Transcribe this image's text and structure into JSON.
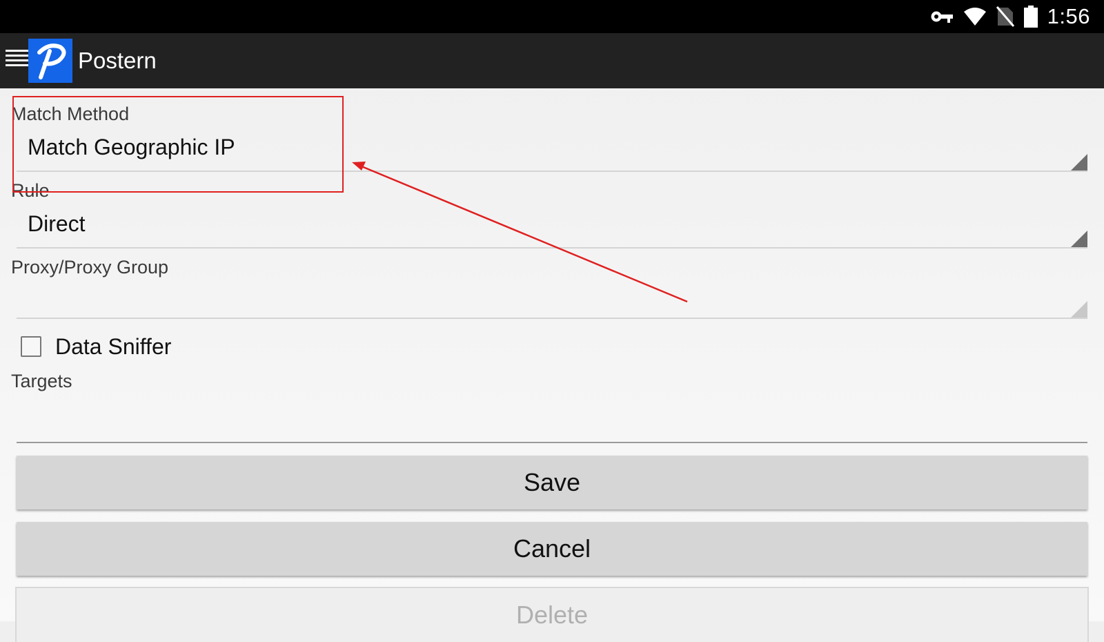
{
  "status_bar": {
    "time": "1:56",
    "icons": [
      "vpn-key-icon",
      "wifi-icon",
      "no-sim-icon",
      "battery-icon"
    ]
  },
  "app_bar": {
    "menu_icon": "hamburger-menu-icon",
    "logo_icon": "postern-logo-icon",
    "title": "Postern"
  },
  "form": {
    "match_method": {
      "label": "Match Method",
      "value": "Match Geographic IP"
    },
    "rule": {
      "label": "Rule",
      "value": "Direct"
    },
    "proxy_group": {
      "label": "Proxy/Proxy Group",
      "value": ""
    },
    "data_sniffer": {
      "label": "Data Sniffer",
      "checked": false
    },
    "targets": {
      "label": "Targets",
      "value": ""
    }
  },
  "buttons": {
    "save": "Save",
    "cancel": "Cancel",
    "delete": "Delete"
  },
  "colors": {
    "status_bar": "#000000",
    "action_bar": "#222222",
    "logo": "#1565e8",
    "annotation": "#e02020",
    "button": "#d6d6d6"
  }
}
